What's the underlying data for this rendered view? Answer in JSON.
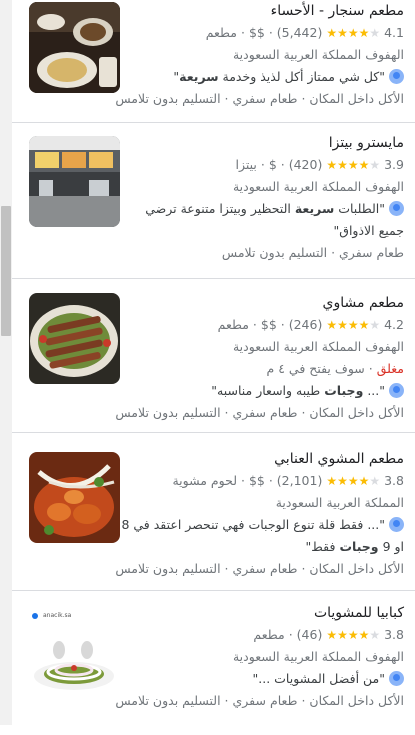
{
  "results": [
    {
      "name": "مطعم سنجار - الأحساء",
      "rating": "4.1",
      "stars_filled": 4,
      "reviews": "(5,442)",
      "price": "$$",
      "category": "مطعم",
      "address": "الهفوف المملكة العربية السعودية",
      "review_pre": "\"كل شي ممتاز أكل لذيذ وخدمة ",
      "review_bold": "سريعة",
      "review_post": "\"",
      "review_line2": "",
      "tags": "الأكل داخل المكان · طعام سفري · التسليم بدون تلامس",
      "status": "",
      "thumb_icon": "food-photo-icon"
    },
    {
      "name": "مايسترو بيتزا",
      "rating": "3.9",
      "stars_filled": 4,
      "reviews": "(420)",
      "price": "$",
      "category": "بيتزا",
      "address": "الهفوف المملكة العربية السعودية",
      "review_pre": "\"الطلبات ",
      "review_bold": "سريعة",
      "review_post": " التحظير وبيتزا متنوعة ترضي",
      "review_line2": "جميع الاذواق\"",
      "tags": "طعام سفري · التسليم بدون تلامس",
      "status": "",
      "thumb_icon": "storefront-photo-icon"
    },
    {
      "name": "مطعم مشاوي",
      "rating": "4.2",
      "stars_filled": 4,
      "reviews": "(246)",
      "price": "$$",
      "category": "مطعم",
      "address": "الهفوف المملكة العربية السعودية",
      "status_closed": "مغلق",
      "status": " · سوف يفتح في ٤ م",
      "review_pre": "\"... ",
      "review_bold": "وجبات",
      "review_post": " طيبه واسعار مناسبه\"",
      "review_line2": "",
      "tags": "الأكل داخل المكان · طعام سفري · التسليم بدون تلامس",
      "thumb_icon": "kebab-platter-photo-icon"
    },
    {
      "name": "مطعم المشوي العنابي",
      "rating": "3.8",
      "stars_filled": 4,
      "reviews": "(2,101)",
      "price": "$$",
      "category": "لحوم مشوية",
      "address": "المملكة العربية السعودية",
      "review_pre": "\"... فقط قلة تنوع الوجبات فهي تنحصر اعتقد في 8",
      "review_bold": "",
      "review_post": "",
      "review_line2_pre": "او 9 ",
      "review_line2_bold": "وجبات",
      "review_line2_post": " فقط\"",
      "tags": "الأكل داخل المكان · طعام سفري · التسليم بدون تلامس",
      "status": "",
      "thumb_icon": "grilled-food-photo-icon"
    },
    {
      "name": "كبابيا للمشويات",
      "rating": "3.8",
      "stars_filled": 4,
      "reviews": "(46)",
      "price": "",
      "category": "مطعم",
      "address": "الهفوف المملكة العربية السعودية",
      "review_pre": "\"من أفضل المشويات ...\"",
      "review_bold": "",
      "review_post": "",
      "review_line2": "",
      "tags": "الأكل داخل المكان · طعام سفري · التسليم بدون تلامس",
      "status": "",
      "thumb_caption": "anacik.sa",
      "thumb_icon": "kebab-onion-photo-icon"
    }
  ],
  "colors": {
    "star": "#fbbc04",
    "closed": "#d93025",
    "divider": "#dadce0"
  }
}
